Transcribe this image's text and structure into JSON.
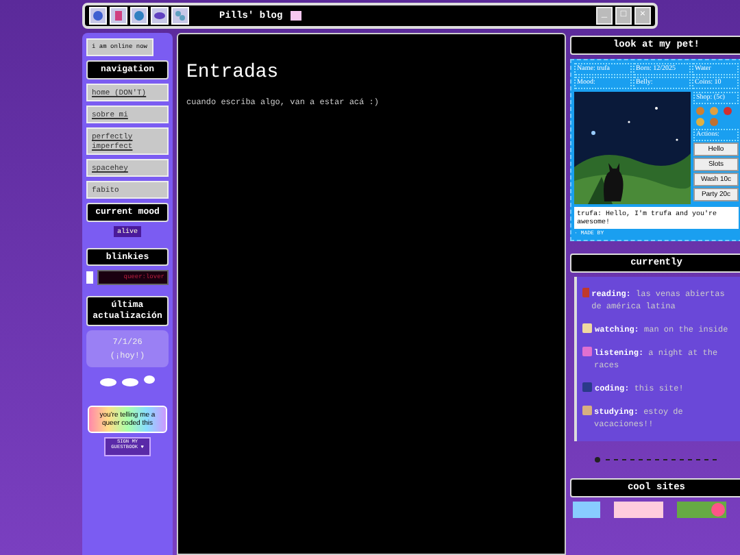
{
  "window": {
    "title": "Pills' blog",
    "controls": [
      "_",
      "□",
      "×"
    ]
  },
  "toolbar_icons": [
    {
      "kind": "globe"
    },
    {
      "kind": "notepad"
    },
    {
      "kind": "gear"
    },
    {
      "kind": "disc"
    },
    {
      "kind": "people"
    }
  ],
  "sidebar": {
    "status": "i am online now",
    "navigation": {
      "title": "navigation",
      "items": [
        {
          "label": "home (DON'T)",
          "selected": false
        },
        {
          "label": "sobre mi",
          "selected": false
        },
        {
          "label": "perfectly imperfect",
          "selected": false
        },
        {
          "label": "spacehey",
          "selected": false
        },
        {
          "label": "fabito",
          "selected": true
        }
      ]
    },
    "mood": {
      "title": "current mood",
      "value": "alive"
    },
    "blinkies": {
      "title": "blinkies",
      "blinky": "queer:lover"
    },
    "update": {
      "title": "última actualización",
      "date": "7/1/26",
      "note": "(¡hoy!)"
    },
    "rainbow_button": "you're telling me a queer coded this",
    "guestbook_button": "SIGN MY GUESTBOOK ♥"
  },
  "main": {
    "title": "Entradas",
    "text": "cuando escriba algo, van a estar acá :)"
  },
  "pet": {
    "title": "look at my pet!",
    "name": "Name: trufa",
    "born": "Born: 12/2025",
    "water": "Water",
    "mood": "Mood:",
    "belly": "Belly:",
    "coins": "Coins: 10",
    "shop": "Shop: (5c)",
    "actions_label": "Actions:",
    "actions": [
      "Hello",
      "Slots",
      "Wash 10c",
      "Party 20c"
    ],
    "message": "trufa: Hello, I'm trufa and you're awesome!",
    "footer": "· MADE BY"
  },
  "currently": {
    "title": "currently",
    "items": [
      {
        "label": "reading:",
        "value": "las venas abiertas de américa latina",
        "color": "#c0392b"
      },
      {
        "label": "watching:",
        "value": "man on the inside",
        "color": "#f0d9a0"
      },
      {
        "label": "listening:",
        "value": "a night at the races",
        "color": "#e070d0"
      },
      {
        "label": "coding:",
        "value": "this site!",
        "color": "#2a3a8a"
      },
      {
        "label": "studying:",
        "value": "estoy de vacaciones!!",
        "color": "#d8b080"
      }
    ]
  },
  "cool_sites": {
    "title": "cool sites"
  }
}
